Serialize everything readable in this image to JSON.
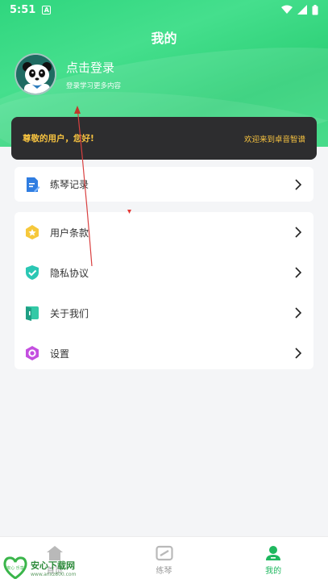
{
  "status_bar": {
    "time": "5:51",
    "notification_letter": "A"
  },
  "header": {
    "title": "我的"
  },
  "profile": {
    "login_text": "点击登录",
    "login_subtitle": "登录学习更多内容"
  },
  "banner": {
    "greeting": "尊敬的用户，您好!",
    "welcome": "欢迎来到卓音智谱"
  },
  "menu_group_1": [
    {
      "label": "练琴记录",
      "icon": "document-icon"
    }
  ],
  "menu_group_2": [
    {
      "label": "用户条款",
      "icon": "star-badge-icon"
    },
    {
      "label": "隐私协议",
      "icon": "shield-check-icon"
    },
    {
      "label": "关于我们",
      "icon": "info-door-icon"
    },
    {
      "label": "设置",
      "icon": "hexagon-settings-icon"
    }
  ],
  "tabbar": {
    "tabs": [
      {
        "label": "首页",
        "icon": "home-icon",
        "active": false
      },
      {
        "label": "练琴",
        "icon": "piano-icon",
        "active": false
      },
      {
        "label": "我的",
        "icon": "user-icon",
        "active": true
      }
    ]
  },
  "watermark": {
    "title": "安心下载网",
    "url": "www.anxz800.com",
    "badge": "安心 乐享"
  },
  "colors": {
    "brand_green": "#2fd67e",
    "banner_bg": "#2d2d2f",
    "banner_text": "#f6c240",
    "active_tab": "#1fb85f"
  }
}
